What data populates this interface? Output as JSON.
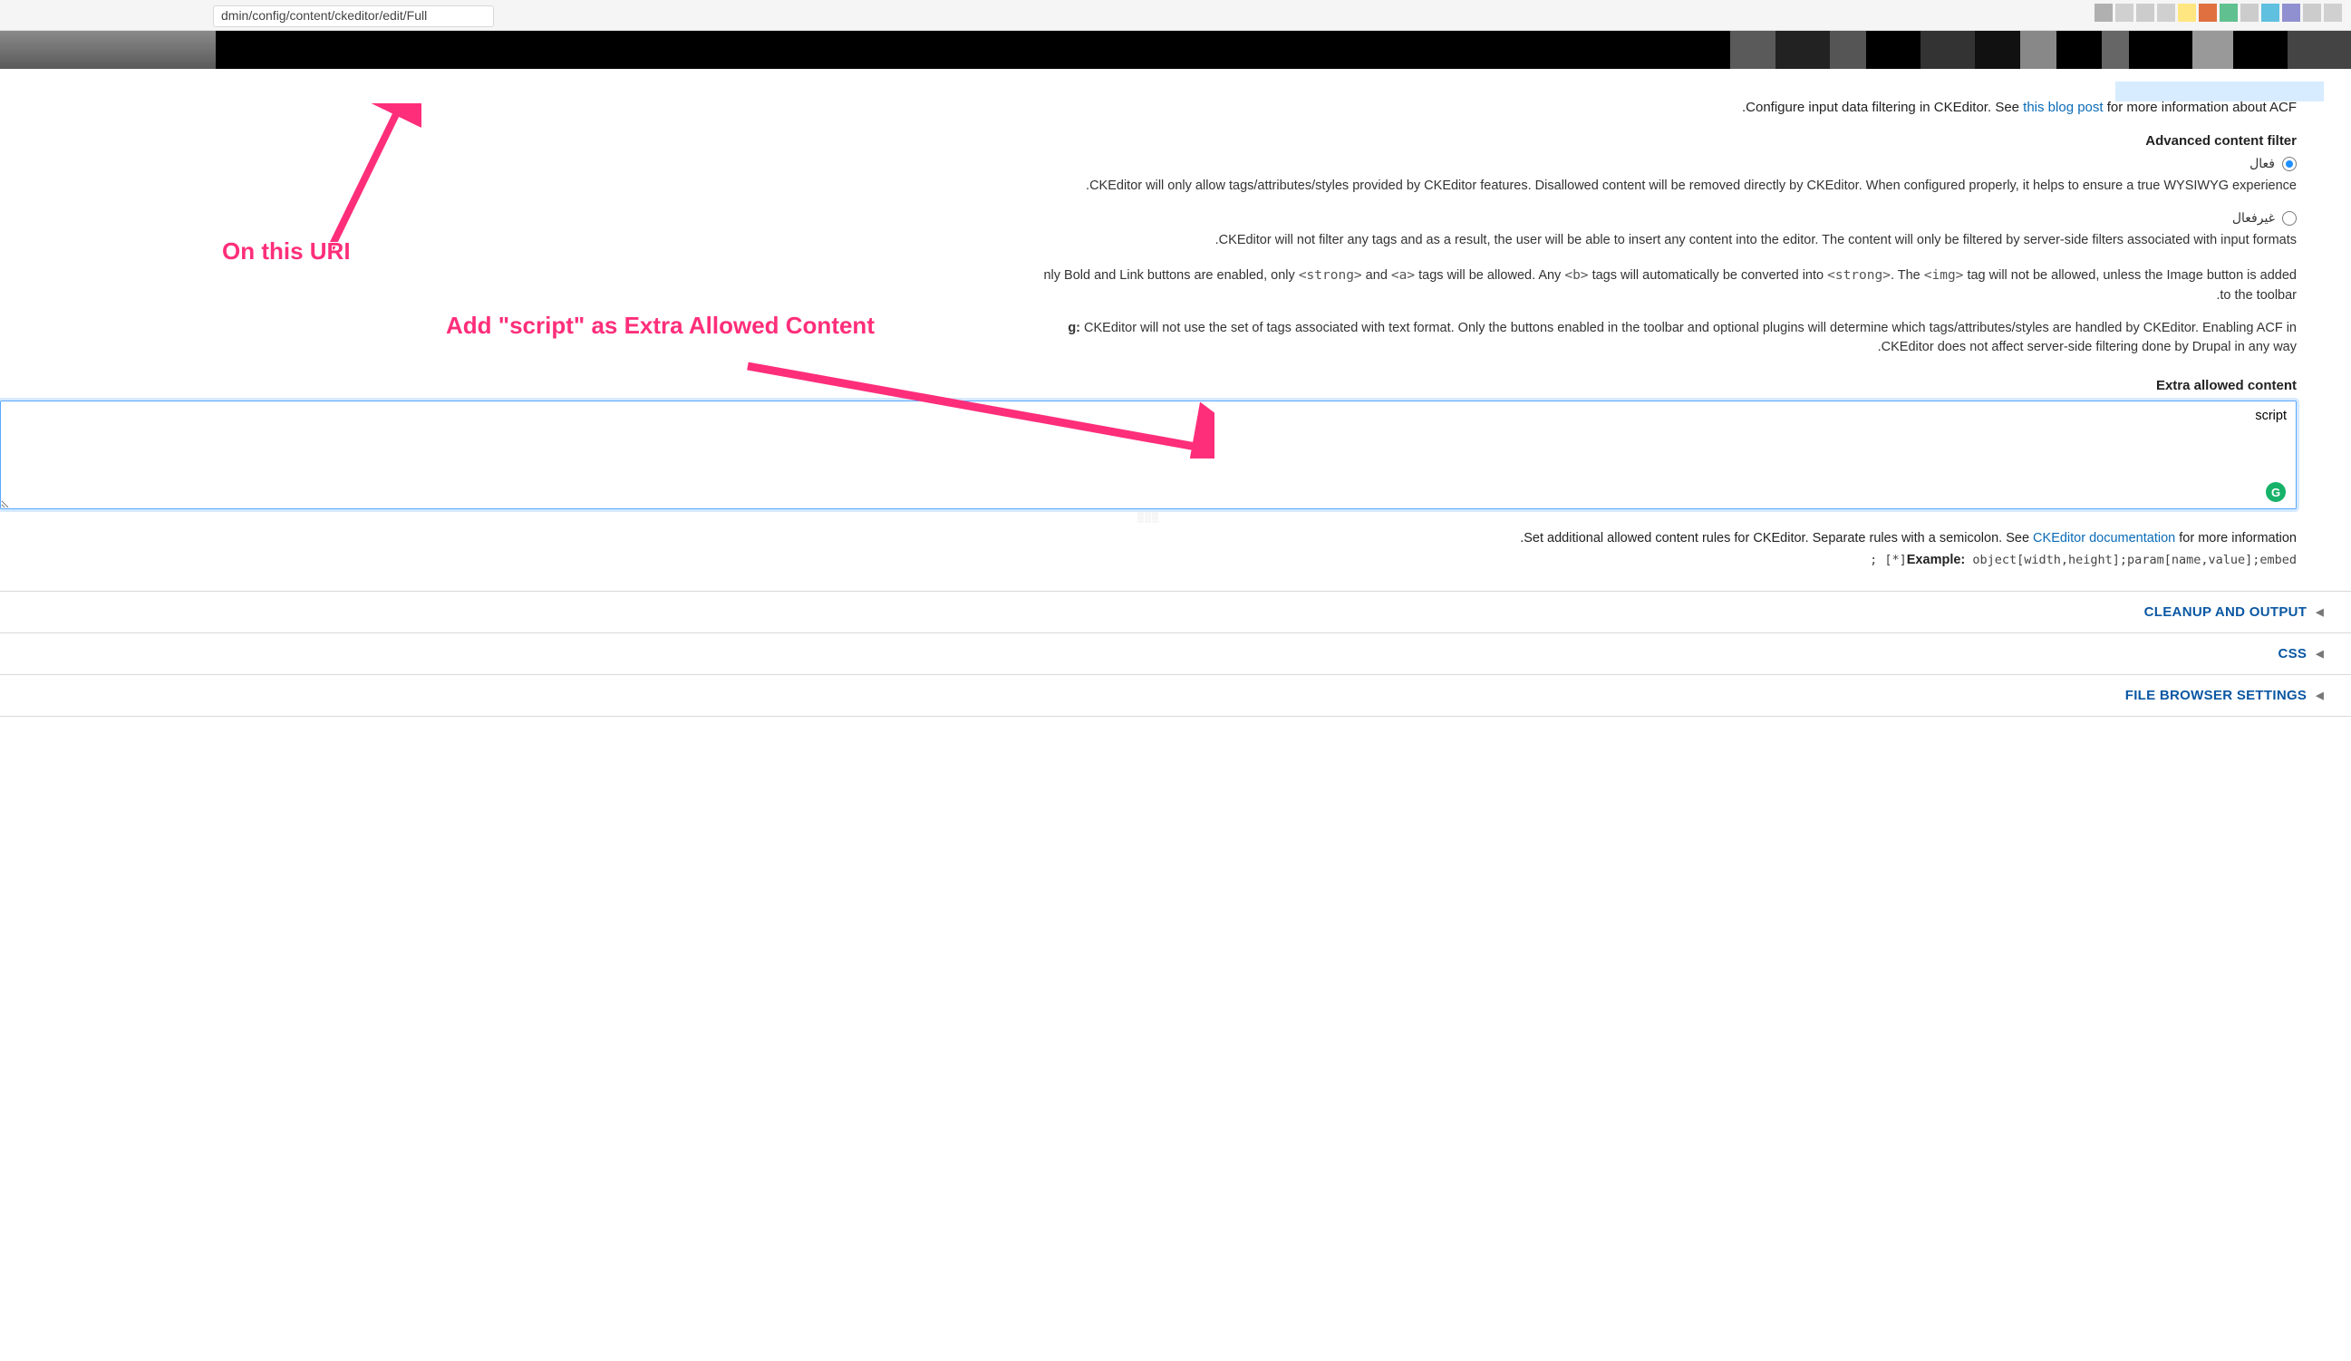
{
  "url_fragment": "dmin/config/content/ckeditor/edit/Full",
  "intro": {
    "leading_dot": ".",
    "before_link": "Configure input data filtering in CKEditor. See ",
    "link_text": "this blog post",
    "after_link": " for more information about ACF"
  },
  "acf": {
    "section_label": "Advanced content filter",
    "options": {
      "enabled": {
        "label": "فعال",
        "checked": true
      },
      "disabled": {
        "label": "غيرفعال",
        "checked": false
      }
    },
    "enabled_desc_prefix": ".",
    "enabled_desc": "CKEditor will only allow tags/attributes/styles provided by CKEditor features. Disallowed content will be removed directly by CKEditor. When configured properly, it helps to ensure a true WYSIWYG experience",
    "disabled_desc_prefix": ".",
    "disabled_desc": "CKEditor will not filter any tags and as a result, the user will be able to insert any content into the editor. The content will only be filtered by server-side filters associated with input formats"
  },
  "para_example": {
    "t1": "nly Bold and Link buttons are enabled, only ",
    "c_strong": "<strong>",
    "t2": " and ",
    "c_a": "<a>",
    "t3": " tags will be allowed. Any ",
    "c_b": "<b>",
    "t4": " tags will automatically be converted into ",
    "c_strong2": "<strong>",
    "t5": ". The ",
    "c_img": "<img>",
    "t6": " tag will not be allowed, unless the Image button is added",
    "tail": ".to the toolbar"
  },
  "para_warning": {
    "lead": "g:",
    "body": " CKEditor will not use the set of tags associated with text format. Only the buttons enabled in the toolbar and optional plugins will determine which tags/attributes/styles are handled by CKEditor. Enabling ACF in",
    "tail": ".CKEditor does not affect server-side filtering done by Drupal in any way"
  },
  "extra": {
    "label": "Extra allowed content",
    "value": "script",
    "help_prefix": ".",
    "help_before": "Set additional allowed content rules for CKEditor. Separate rules with a semicolon. See ",
    "help_link": "CKEditor documentation",
    "help_after": " for more information",
    "example_label": "Example:",
    "example_code": " object[width,height];param[name,value];embed",
    "example_code_prefix": "; [*]"
  },
  "accordions": [
    {
      "label": "CLEANUP AND OUTPUT"
    },
    {
      "label": "CSS"
    },
    {
      "label": "FILE BROWSER SETTINGS"
    }
  ],
  "annotations": {
    "uri_note": "On this URI",
    "extra_note": "Add \"script\" as Extra Allowed Content"
  },
  "grammarly_badge": "G"
}
